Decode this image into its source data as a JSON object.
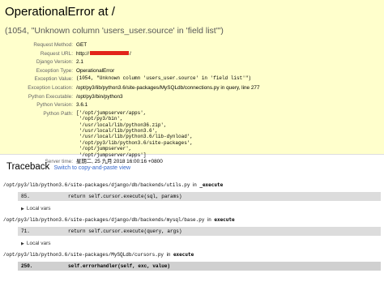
{
  "header": {
    "title": "OperationalError at /",
    "exception_value_line": "(1054, \"Unknown column 'users_user.source' in 'field list'\")"
  },
  "meta": [
    {
      "label": "Request Method:",
      "value": "GET"
    },
    {
      "label": "Request URL:",
      "value_prefix": "http://",
      "value_suffix": "/"
    },
    {
      "label": "Django Version:",
      "value": "2.1"
    },
    {
      "label": "Exception Type:",
      "value": "OperationalError"
    },
    {
      "label": "Exception Value:",
      "value": "(1054, \"Unknown column 'users_user.source' in 'field list'\")"
    },
    {
      "label": "Exception Location:",
      "value": "/opt/py3/lib/python3.6/site-packages/MySQLdb/connections.py in query, line 277"
    },
    {
      "label": "Python Executable:",
      "value": "/opt/py3/bin/python3"
    },
    {
      "label": "Python Version:",
      "value": "3.6.1"
    },
    {
      "label": "Python Path:",
      "value": "['/opt/jumpserver/apps',\n '/opt/py3/bin',\n '/usr/local/lib/python36.zip',\n '/usr/local/lib/python3.6',\n '/usr/local/lib/python3.6/lib-dynload',\n '/opt/py3/lib/python3.6/site-packages',\n '/opt/jumpserver',\n '/opt/jumpserver/apps']"
    },
    {
      "label": "Server time:",
      "value": "星期二, 25 九月 2018 16:00:16 +0800"
    }
  ],
  "traceback": {
    "title": "Traceback",
    "switch_link": "Switch to copy-and-paste view",
    "in_word": "in",
    "local_vars_label": "Local vars",
    "frames": [
      {
        "file": "/opt/py3/lib/python3.6/site-packages/django/db/backends/utils.py",
        "func": "_execute",
        "lineno": "85.",
        "code": "return self.cursor.execute(sql, params)"
      },
      {
        "file": "/opt/py3/lib/python3.6/site-packages/django/db/backends/mysql/base.py",
        "func": "execute",
        "lineno": "71.",
        "code": "return self.cursor.execute(query, args)"
      },
      {
        "file": "/opt/py3/lib/python3.6/site-packages/MySQLdb/cursors.py",
        "func": "execute",
        "lineno": "250.",
        "code": "self.errorhandler(self, exc, value)"
      }
    ]
  },
  "colors": {
    "summary_bg": "#ffffcc",
    "link": "#3366cc",
    "redaction": "#e2231a",
    "context_bg": "#dcdcdc"
  }
}
